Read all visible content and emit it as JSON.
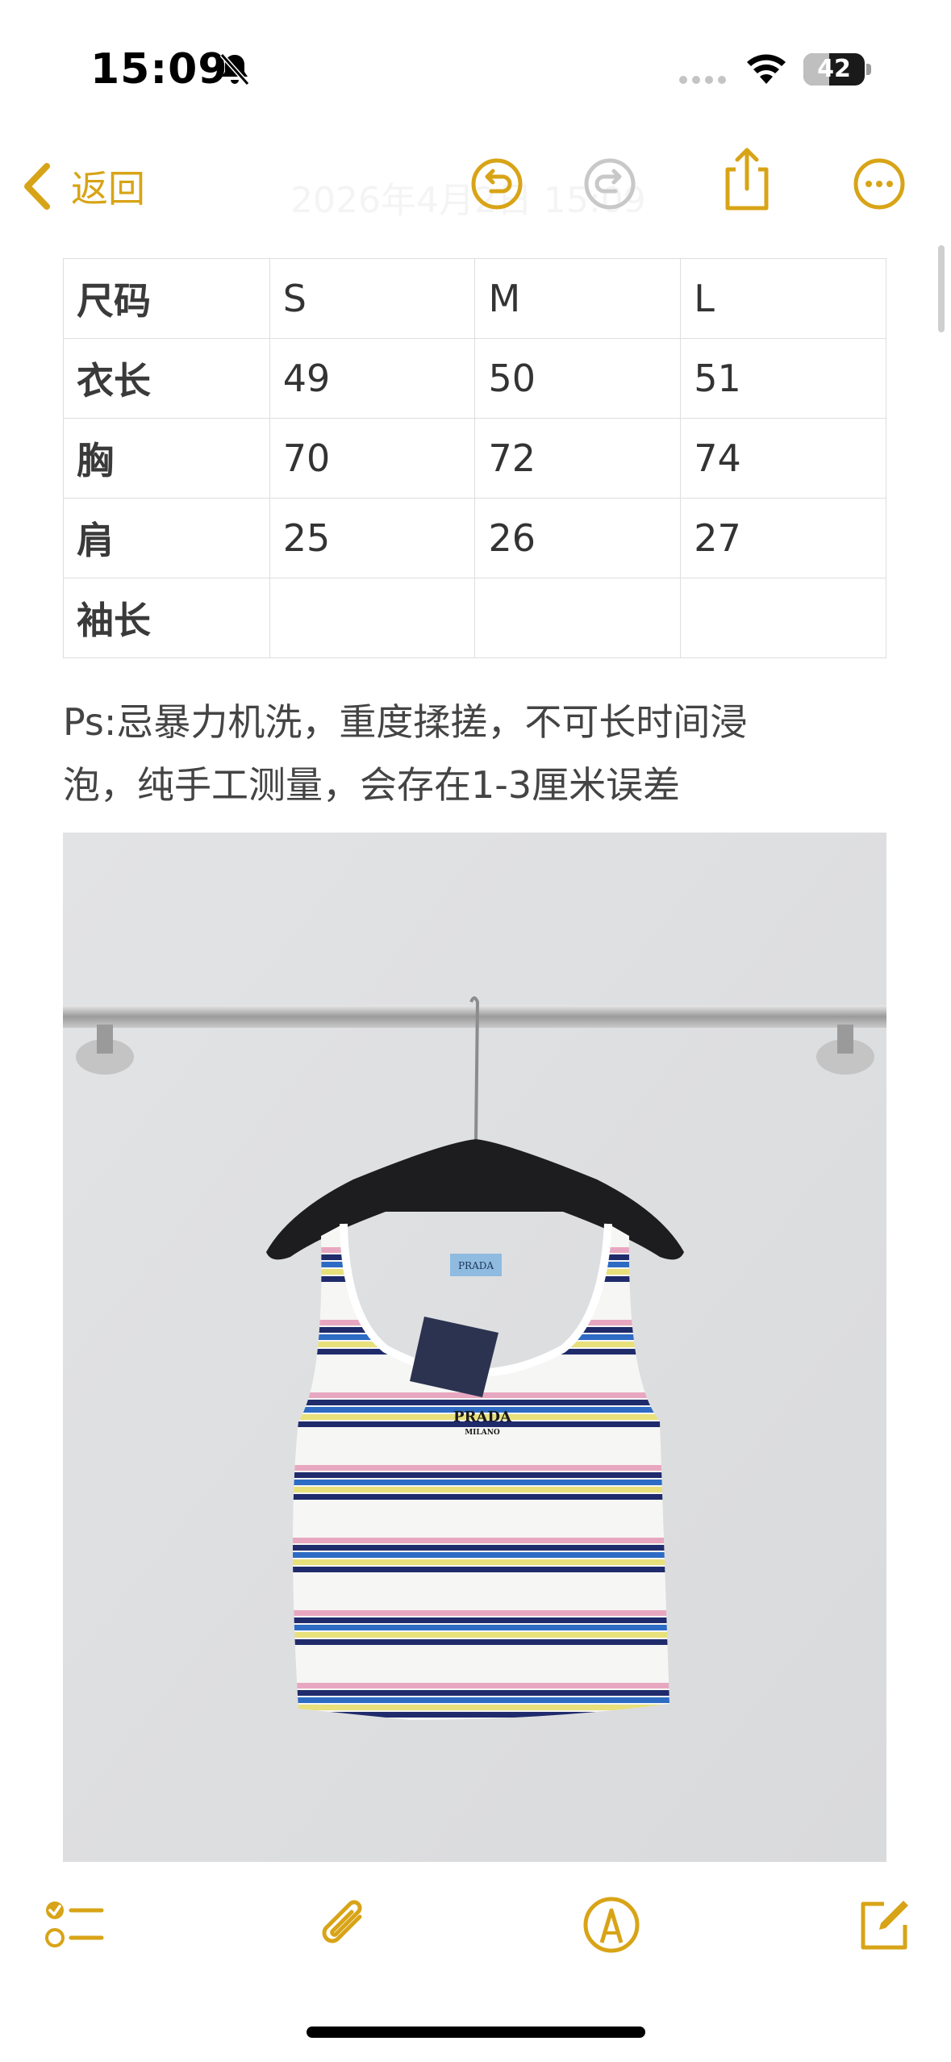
{
  "status_bar": {
    "time": "15:09",
    "battery_percent": "42",
    "battery_level": 0.42
  },
  "nav": {
    "back_label": "返回",
    "title": "2026年4月2日 15:09"
  },
  "size_table": {
    "rows": [
      [
        "尺码",
        "S",
        "M",
        "L"
      ],
      [
        "衣长",
        "49",
        "50",
        "51"
      ],
      [
        "胸",
        "70",
        "72",
        "74"
      ],
      [
        "肩",
        "25",
        "26",
        "27"
      ],
      [
        "袖长",
        "",
        "",
        ""
      ]
    ]
  },
  "note": {
    "line1": "Ps:忌暴力机洗，重度揉搓，不可长时间浸",
    "line2": "泡，纯手工测量，会存在1-3厘米误差"
  },
  "photo": {
    "label_brand": "PRADA",
    "embroidery_top": "PRADA",
    "embroidery_bottom": "MILANO"
  },
  "icons": {
    "accent": "#d8a417",
    "disabled": "#c8c8c8",
    "back": "chevron-left-icon",
    "undo": "undo-icon",
    "redo": "redo-icon",
    "share": "share-icon",
    "more": "more-icon",
    "checklist": "checklist-icon",
    "attachment": "paperclip-icon",
    "markup": "markup-pen-icon",
    "compose": "compose-icon"
  }
}
